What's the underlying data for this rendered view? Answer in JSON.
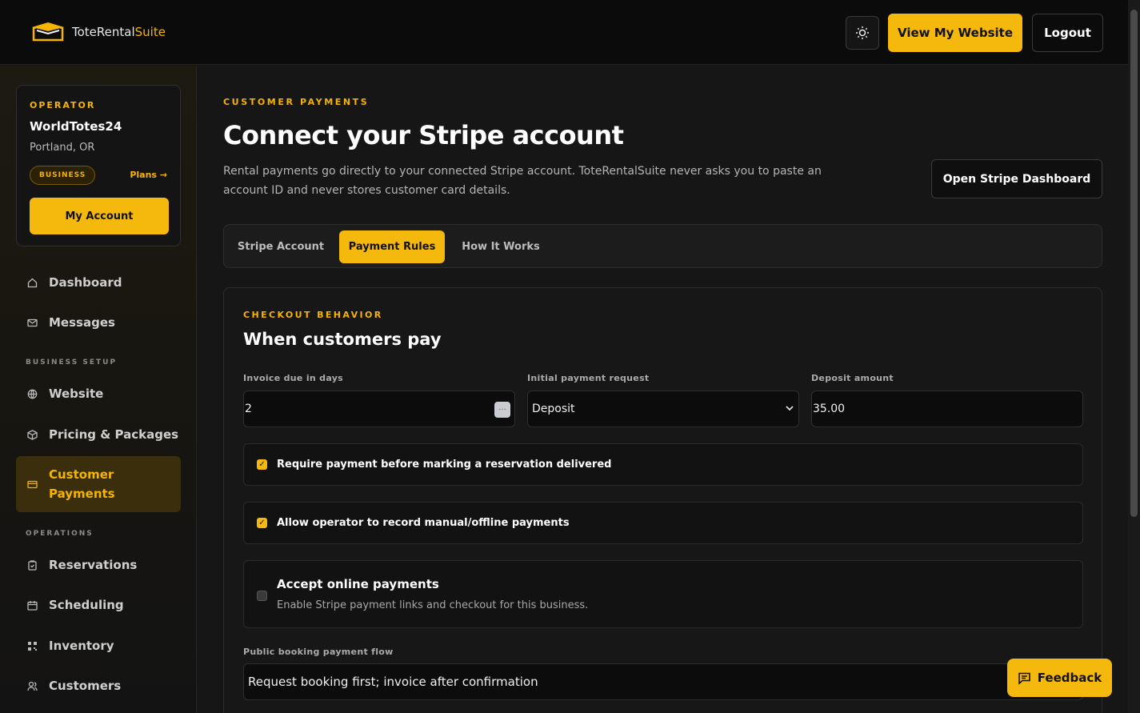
{
  "header": {
    "logo_prefix": "ToteRental",
    "logo_accent": "Suite",
    "view_site_label": "View My Website",
    "logout_label": "Logout",
    "theme_icon": "sun-icon"
  },
  "operator": {
    "label": "OPERATOR",
    "name": "WorldTotes24",
    "location": "Portland, OR",
    "plan_badge": "BUSINESS",
    "plans_link": "Plans →",
    "account_button": "My Account"
  },
  "sidebar": {
    "items": [
      {
        "label": "Dashboard",
        "icon": "home-icon"
      },
      {
        "label": "Messages",
        "icon": "mail-icon"
      },
      {
        "label": "Website",
        "icon": "globe-icon"
      },
      {
        "label": "Pricing & Packages",
        "icon": "package-icon"
      },
      {
        "label": "Customer Payments",
        "icon": "card-icon",
        "active": true
      },
      {
        "label": "Reservations",
        "icon": "clipboard-icon"
      },
      {
        "label": "Scheduling",
        "icon": "calendar-icon"
      },
      {
        "label": "Inventory",
        "icon": "grid-icon"
      },
      {
        "label": "Customers",
        "icon": "users-icon"
      }
    ],
    "sections": [
      "BUSINESS SETUP",
      "OPERATIONS"
    ]
  },
  "main": {
    "eyebrow": "CUSTOMER PAYMENTS",
    "title": "Connect your Stripe account",
    "description": "Rental payments go directly to your connected Stripe account. ToteRentalSuite never asks you to paste an account ID and never stores customer card details.",
    "stripe_button": "Open Stripe Dashboard",
    "tabs": [
      {
        "label": "Stripe Account"
      },
      {
        "label": "Payment Rules",
        "active": true
      },
      {
        "label": "How It Works"
      }
    ]
  },
  "checkout": {
    "eyebrow": "CHECKOUT BEHAVIOR",
    "title": "When customers pay",
    "invoice_label": "Invoice due in days",
    "invoice_value": "2",
    "initial_label": "Initial payment request",
    "initial_value": "Deposit",
    "deposit_label": "Deposit amount",
    "deposit_value": "35.00",
    "options": [
      {
        "label": "Require payment before marking a reservation delivered",
        "checked": true
      },
      {
        "label": "Allow operator to record manual/offline payments",
        "checked": true
      },
      {
        "label": "Accept online payments",
        "sub": "Enable Stripe payment links and checkout for this business.",
        "checked": false
      }
    ],
    "flow_label": "Public booking payment flow",
    "flow_value": "Request booking first; invoice after confirmation"
  },
  "feedback_label": "Feedback",
  "colors": {
    "accent": "#f5b80c",
    "background": "#161616"
  }
}
